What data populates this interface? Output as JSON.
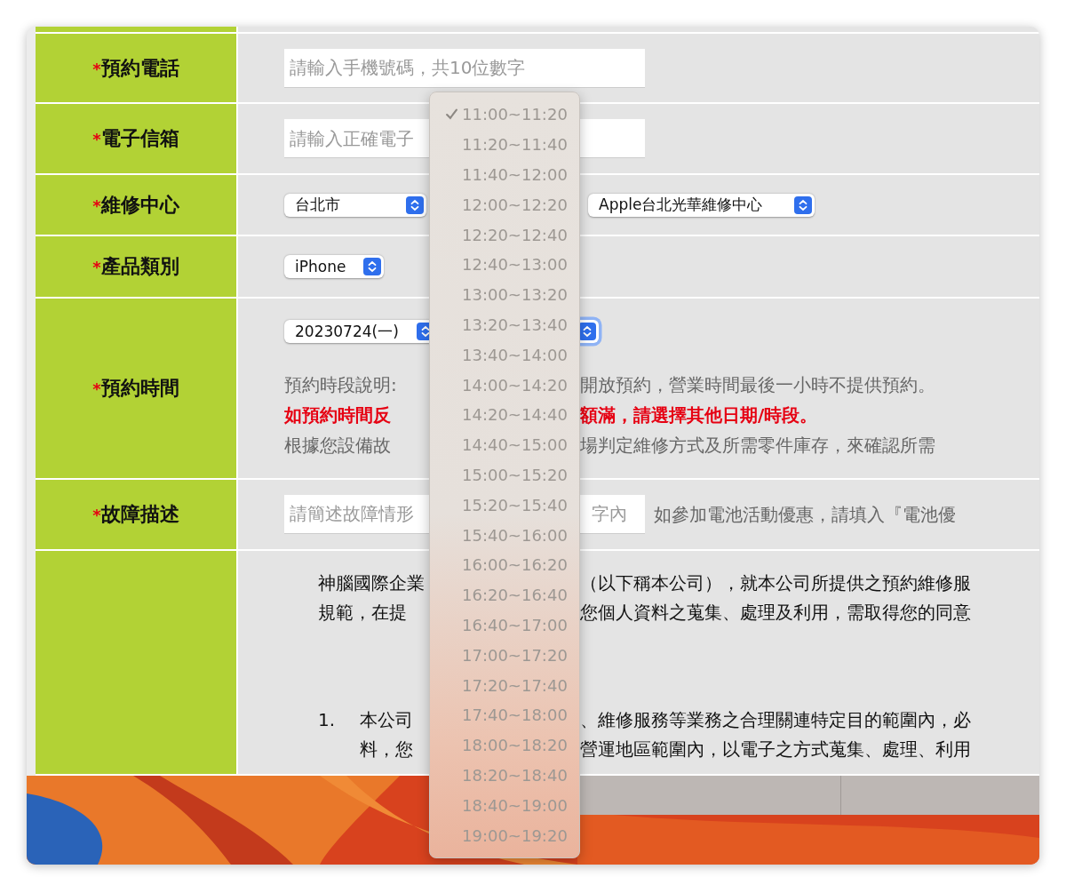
{
  "form": {
    "rows": [
      {
        "kind": "input",
        "mark": "*",
        "label": "預約電話",
        "placeholder": "請輸入手機號碼，共10位數字"
      },
      {
        "kind": "input",
        "mark": "*",
        "label": "電子信箱",
        "placeholder": "請輸入正確電子"
      },
      {
        "kind": "centers",
        "mark": "*",
        "label": "維修中心",
        "selects": [
          "台北市",
          "Apple台北光華維修中心"
        ]
      },
      {
        "kind": "product",
        "mark": "*",
        "label": "產品類別",
        "selects": [
          "iPhone"
        ]
      },
      {
        "kind": "time",
        "mark": "*",
        "label": "預約時間",
        "date": "20230724(一)",
        "time_focused": true,
        "notes": [
          {
            "kind": "normal",
            "left": "預約時段說明:",
            "right": "開放預約，營業時間最後一小時不提供預約。"
          },
          {
            "kind": "warning",
            "left": "如預約時間反",
            "right": "額滿，請選擇其他日期/時段。"
          },
          {
            "kind": "normal",
            "left": "根據您設備故",
            "right": "場判定維修方式及所需零件庫存，來確認所需"
          }
        ]
      },
      {
        "kind": "description",
        "mark": "*",
        "label": "故障描述",
        "placeholder_start": "請簡述故障情形",
        "placeholder_end": "字內",
        "hint": "如參加電池活動優惠，請填入『電池優"
      },
      {
        "kind": "terms",
        "lines": [
          {
            "kind": "para",
            "left": "神腦國際企業",
            "right": "（以下稱本公司），就本公司所提供之預約維修服"
          },
          {
            "kind": "para",
            "left": "規範，在提",
            "right": "您個人資料之蒐集、處理及利用，需取得您的同意"
          },
          {
            "kind": "gap"
          },
          {
            "kind": "item",
            "number": "1.",
            "left": "本公司",
            "right": "、維修服務等業務之合理關連特定目的範圍內，必"
          },
          {
            "kind": "item",
            "left": "料，您",
            "right": "營運地區範圍內，以電子之方式蒐集、處理、利用"
          }
        ]
      }
    ]
  },
  "time_menu": {
    "options": [
      {
        "label": "11:00~11:20",
        "selected": true,
        "disabled": true
      },
      {
        "label": "11:20~11:40",
        "selected": false,
        "disabled": true
      },
      {
        "label": "11:40~12:00",
        "selected": false,
        "disabled": true
      },
      {
        "label": "12:00~12:20",
        "selected": false,
        "disabled": true
      },
      {
        "label": "12:20~12:40",
        "selected": false,
        "disabled": true
      },
      {
        "label": "12:40~13:00",
        "selected": false,
        "disabled": true
      },
      {
        "label": "13:00~13:20",
        "selected": false,
        "disabled": true
      },
      {
        "label": "13:20~13:40",
        "selected": false,
        "disabled": true
      },
      {
        "label": "13:40~14:00",
        "selected": false,
        "disabled": true
      },
      {
        "label": "14:00~14:20",
        "selected": false,
        "disabled": true
      },
      {
        "label": "14:20~14:40",
        "selected": false,
        "disabled": true
      },
      {
        "label": "14:40~15:00",
        "selected": false,
        "disabled": true
      },
      {
        "label": "15:00~15:20",
        "selected": false,
        "disabled": true
      },
      {
        "label": "15:20~15:40",
        "selected": false,
        "disabled": true
      },
      {
        "label": "15:40~16:00",
        "selected": false,
        "disabled": true
      },
      {
        "label": "16:00~16:20",
        "selected": false,
        "disabled": true
      },
      {
        "label": "16:20~16:40",
        "selected": false,
        "disabled": true
      },
      {
        "label": "16:40~17:00",
        "selected": false,
        "disabled": true
      },
      {
        "label": "17:00~17:20",
        "selected": false,
        "disabled": true
      },
      {
        "label": "17:20~17:40",
        "selected": false,
        "disabled": true
      },
      {
        "label": "17:40~18:00",
        "selected": false,
        "disabled": true
      },
      {
        "label": "18:00~18:20",
        "selected": false,
        "disabled": true
      },
      {
        "label": "18:20~18:40",
        "selected": false,
        "disabled": true
      },
      {
        "label": "18:40~19:00",
        "selected": false,
        "disabled": true
      },
      {
        "label": "19:00~19:20",
        "selected": false,
        "disabled": true
      }
    ]
  }
}
